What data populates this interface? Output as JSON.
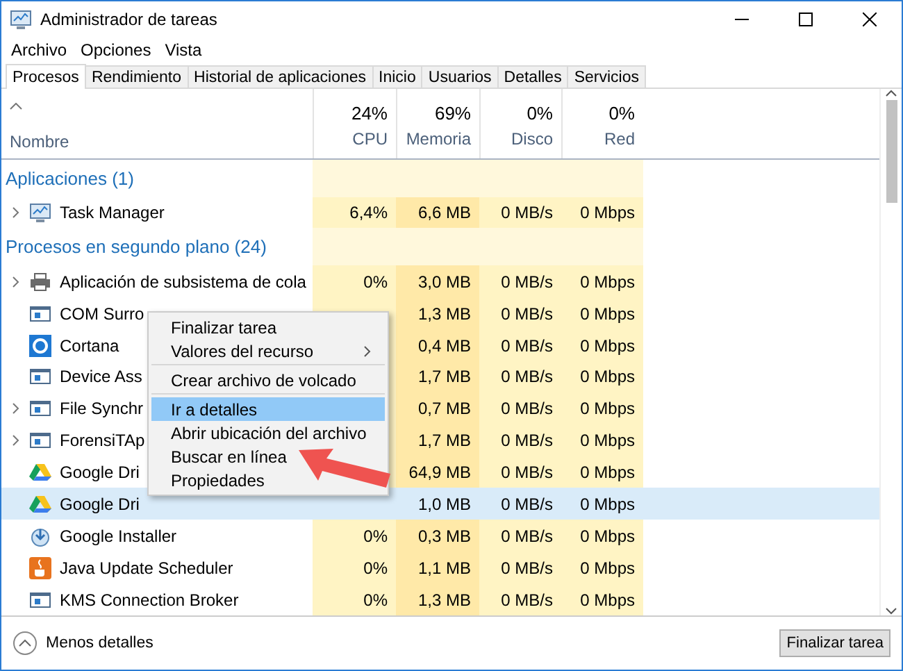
{
  "window": {
    "title": "Administrador de tareas"
  },
  "menu_bar": [
    "Archivo",
    "Opciones",
    "Vista"
  ],
  "tabs": [
    {
      "label": "Procesos",
      "selected": true
    },
    {
      "label": "Rendimiento",
      "selected": false
    },
    {
      "label": "Historial de aplicaciones",
      "selected": false
    },
    {
      "label": "Inicio",
      "selected": false
    },
    {
      "label": "Usuarios",
      "selected": false
    },
    {
      "label": "Detalles",
      "selected": false
    },
    {
      "label": "Servicios",
      "selected": false
    }
  ],
  "table": {
    "name_column": "Nombre",
    "columns": [
      {
        "usage": "24%",
        "label": "CPU"
      },
      {
        "usage": "69%",
        "label": "Memoria"
      },
      {
        "usage": "0%",
        "label": "Disco"
      },
      {
        "usage": "0%",
        "label": "Red"
      }
    ],
    "rows": [
      {
        "kind": "group",
        "label": "Aplicaciones (1)"
      },
      {
        "kind": "process",
        "expandable": true,
        "selected": false,
        "name": "Task Manager",
        "cells": [
          "6,4%",
          "6,6 MB",
          "0 MB/s",
          "0 Mbps"
        ]
      },
      {
        "kind": "group",
        "label": "Procesos en segundo plano (24)"
      },
      {
        "kind": "process",
        "expandable": true,
        "selected": false,
        "name": "Aplicación de subsistema de cola",
        "cells": [
          "0%",
          "3,0 MB",
          "0 MB/s",
          "0 Mbps"
        ]
      },
      {
        "kind": "process",
        "expandable": false,
        "selected": false,
        "name": "COM Surro",
        "cells": [
          null,
          "1,3 MB",
          "0 MB/s",
          "0 Mbps"
        ]
      },
      {
        "kind": "process",
        "expandable": false,
        "selected": false,
        "name": "Cortana",
        "cells": [
          null,
          "0,4 MB",
          "0 MB/s",
          "0 Mbps"
        ]
      },
      {
        "kind": "process",
        "expandable": false,
        "selected": false,
        "name": "Device Ass",
        "cells": [
          null,
          "1,7 MB",
          "0 MB/s",
          "0 Mbps"
        ]
      },
      {
        "kind": "process",
        "expandable": true,
        "selected": false,
        "name": "File Synchr",
        "cells": [
          null,
          "0,7 MB",
          "0 MB/s",
          "0 Mbps"
        ]
      },
      {
        "kind": "process",
        "expandable": true,
        "selected": false,
        "name": "ForensiTAp",
        "cells": [
          null,
          "1,7 MB",
          "0 MB/s",
          "0 Mbps"
        ]
      },
      {
        "kind": "process",
        "expandable": false,
        "selected": false,
        "name": "Google Dri",
        "cells": [
          null,
          "64,9 MB",
          "0 MB/s",
          "0 Mbps"
        ]
      },
      {
        "kind": "process",
        "expandable": false,
        "selected": true,
        "name": "Google Dri",
        "cells": [
          null,
          "1,0 MB",
          "0 MB/s",
          "0 Mbps"
        ]
      },
      {
        "kind": "process",
        "expandable": false,
        "selected": false,
        "name": "Google Installer",
        "cells": [
          "0%",
          "0,3 MB",
          "0 MB/s",
          "0 Mbps"
        ]
      },
      {
        "kind": "process",
        "expandable": false,
        "selected": false,
        "name": "Java Update Scheduler",
        "cells": [
          "0%",
          "1,1 MB",
          "0 MB/s",
          "0 Mbps"
        ]
      },
      {
        "kind": "process",
        "expandable": false,
        "selected": false,
        "name": "KMS Connection Broker",
        "cells": [
          "0%",
          "1,3 MB",
          "0 MB/s",
          "0 Mbps"
        ]
      }
    ]
  },
  "context_menu": [
    {
      "label": "Finalizar tarea",
      "submenu": false,
      "separator_after": false,
      "selected": false
    },
    {
      "label": "Valores del recurso",
      "submenu": true,
      "separator_after": true,
      "selected": false
    },
    {
      "label": "Crear archivo de volcado",
      "submenu": false,
      "separator_after": true,
      "selected": false
    },
    {
      "label": "Ir a detalles",
      "submenu": false,
      "separator_after": false,
      "selected": true
    },
    {
      "label": "Abrir ubicación del archivo",
      "submenu": false,
      "separator_after": false,
      "selected": false
    },
    {
      "label": "Buscar en línea",
      "submenu": false,
      "separator_after": false,
      "selected": false
    },
    {
      "label": "Propiedades",
      "submenu": false,
      "separator_after": false,
      "selected": false
    }
  ],
  "footer": {
    "toggle": "Menos detalles",
    "button": "Finalizar tarea"
  }
}
